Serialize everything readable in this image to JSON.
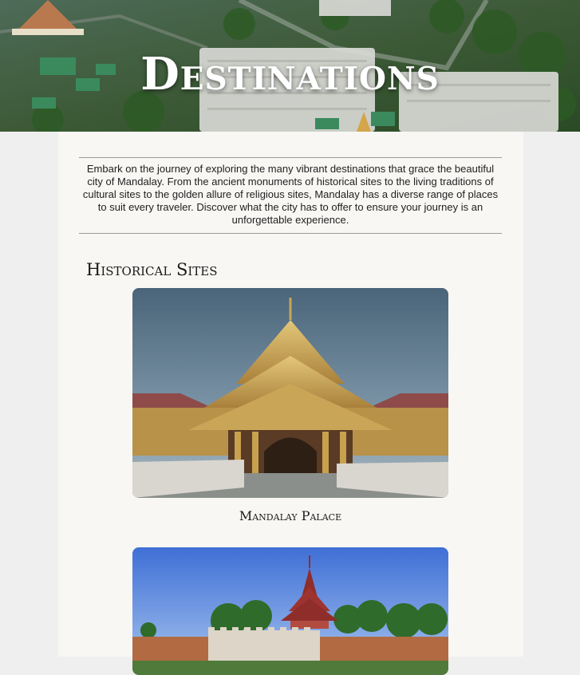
{
  "hero": {
    "title": "Destinations"
  },
  "intro": {
    "text": "Embark on the journey of exploring the many vibrant destinations that grace the beautiful city of Mandalay. From the ancient monuments of historical sites to the living traditions of cultural sites to the golden allure of religious sites, Mandalay has a diverse range of places to suit every traveler. Discover what the city has to offer to ensure your journey is an unforgettable experience."
  },
  "sections": [
    {
      "title": "Historical Sites",
      "places": [
        {
          "name": "Mandalay Palace"
        },
        {
          "name": ""
        }
      ]
    }
  ],
  "colors": {
    "page_bg": "#efefef",
    "content_bg": "#f8f7f4",
    "text": "#1f1f1f",
    "divider": "#9a9a9a"
  }
}
